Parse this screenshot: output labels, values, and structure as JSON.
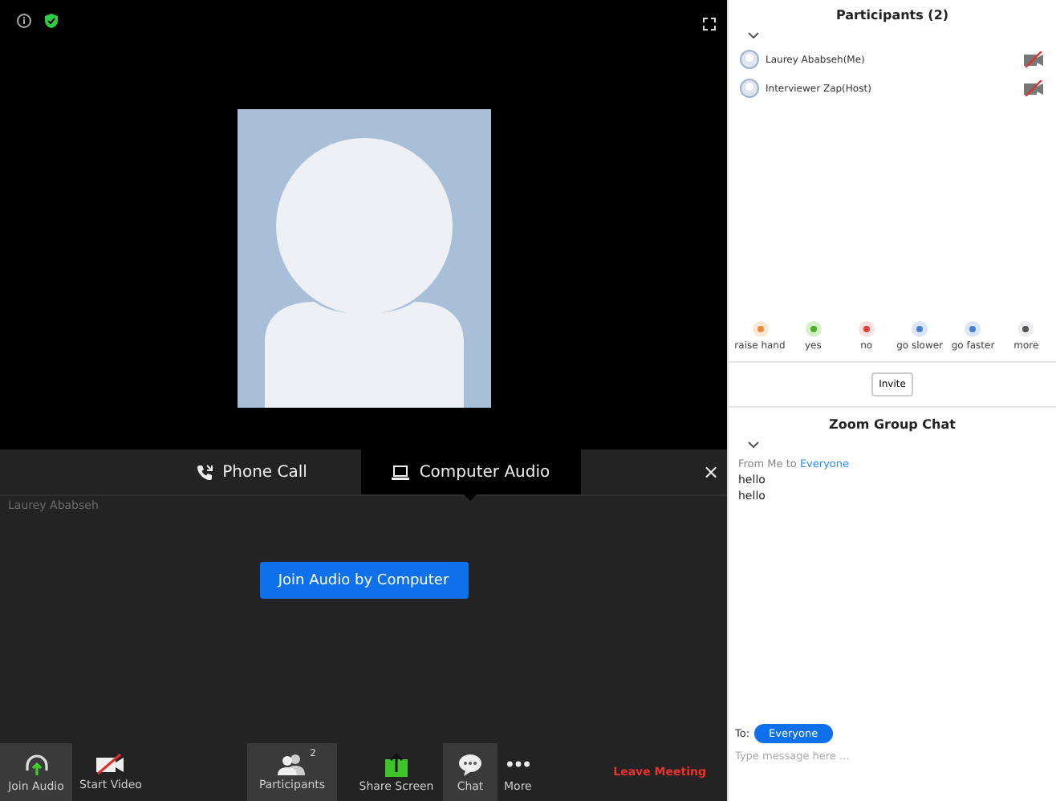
{
  "video": {
    "name_label": "Laurey Ababseh"
  },
  "audio_tabs": [
    {
      "label": "Phone Call",
      "kind": "phone",
      "selected": false
    },
    {
      "label": "Computer Audio",
      "kind": "computer",
      "selected": true
    }
  ],
  "close_button": "×",
  "join_button": "Join Audio by Computer",
  "toolbar": [
    {
      "label": "Join Audio",
      "kind": "headphones",
      "active": true
    },
    {
      "label": "Start Video",
      "kind": "video",
      "active": false
    },
    {
      "label": "Participants",
      "kind": "people",
      "active": true,
      "badge": "2"
    },
    {
      "label": "Share Screen",
      "kind": "share",
      "active": false
    },
    {
      "label": "Chat",
      "kind": "chat",
      "active": true
    },
    {
      "label": "More",
      "kind": "more",
      "active": false
    }
  ],
  "leave_button": "Leave Meeting",
  "sidebar": {
    "title": "Participants (2)",
    "participants": [
      {
        "name": "Laurey Ababseh(Me)",
        "video_off": true
      },
      {
        "name": "Interviewer Zap(Host)",
        "video_off": true
      }
    ],
    "reactions": [
      {
        "label": "raise hand",
        "kind": "hand"
      },
      {
        "label": "yes",
        "kind": "yes"
      },
      {
        "label": "no",
        "kind": "no"
      },
      {
        "label": "go slower",
        "kind": "slower"
      },
      {
        "label": "go faster",
        "kind": "faster"
      },
      {
        "label": "more",
        "kind": "more"
      }
    ],
    "invite_button": "Invite",
    "chat_title": "Zoom Group Chat",
    "messages": [
      {
        "from": "From Me to",
        "to": "Everyone",
        "lines": [
          "hello",
          "hello"
        ]
      }
    ],
    "to_label": "To:",
    "recipient": "Everyone",
    "placeholder": "Type message here ..."
  }
}
